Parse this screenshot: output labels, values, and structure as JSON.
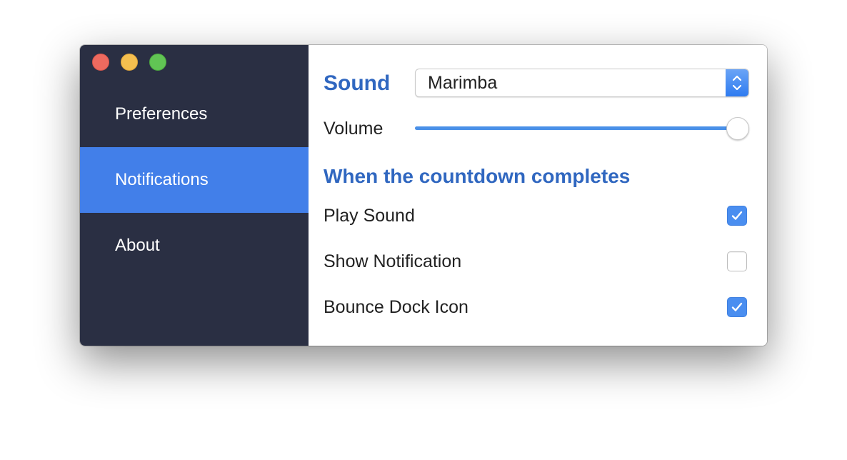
{
  "window": {
    "traffic_lights": [
      "close",
      "minimize",
      "zoom"
    ]
  },
  "sidebar": {
    "items": [
      {
        "label": "Preferences",
        "active": false
      },
      {
        "label": "Notifications",
        "active": true
      },
      {
        "label": "About",
        "active": false
      }
    ]
  },
  "content": {
    "sound": {
      "title": "Sound",
      "selected": "Marimba"
    },
    "volume": {
      "label": "Volume",
      "value_percent": 100
    },
    "countdown": {
      "title": "When the countdown completes",
      "options": [
        {
          "label": "Play Sound",
          "checked": true
        },
        {
          "label": "Show Notification",
          "checked": false
        },
        {
          "label": "Bounce Dock Icon",
          "checked": true
        }
      ]
    }
  },
  "colors": {
    "sidebar_bg": "#2a2f43",
    "active_item": "#427fe9",
    "heading": "#3067c0",
    "checkbox_on": "#4a8ef0",
    "slider_fill": "#4a90e8"
  }
}
